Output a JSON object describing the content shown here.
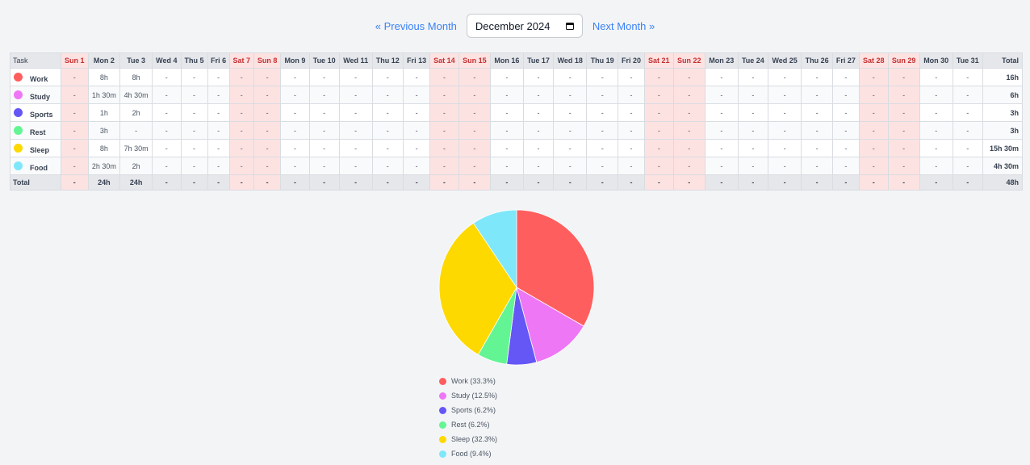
{
  "nav": {
    "prev_label": "« Previous Month",
    "next_label": "Next Month »",
    "month_value": "December 2024"
  },
  "table": {
    "task_header": "Task",
    "total_header": "Total",
    "days": [
      {
        "label": "Sun 1",
        "weekend": true
      },
      {
        "label": "Mon 2",
        "weekend": false
      },
      {
        "label": "Tue 3",
        "weekend": false
      },
      {
        "label": "Wed 4",
        "weekend": false
      },
      {
        "label": "Thu 5",
        "weekend": false
      },
      {
        "label": "Fri 6",
        "weekend": false
      },
      {
        "label": "Sat 7",
        "weekend": true
      },
      {
        "label": "Sun 8",
        "weekend": true
      },
      {
        "label": "Mon 9",
        "weekend": false
      },
      {
        "label": "Tue 10",
        "weekend": false
      },
      {
        "label": "Wed 11",
        "weekend": false
      },
      {
        "label": "Thu 12",
        "weekend": false
      },
      {
        "label": "Fri 13",
        "weekend": false
      },
      {
        "label": "Sat 14",
        "weekend": true
      },
      {
        "label": "Sun 15",
        "weekend": true
      },
      {
        "label": "Mon 16",
        "weekend": false
      },
      {
        "label": "Tue 17",
        "weekend": false
      },
      {
        "label": "Wed 18",
        "weekend": false
      },
      {
        "label": "Thu 19",
        "weekend": false
      },
      {
        "label": "Fri 20",
        "weekend": false
      },
      {
        "label": "Sat 21",
        "weekend": true
      },
      {
        "label": "Sun 22",
        "weekend": true
      },
      {
        "label": "Mon 23",
        "weekend": false
      },
      {
        "label": "Tue 24",
        "weekend": false
      },
      {
        "label": "Wed 25",
        "weekend": false
      },
      {
        "label": "Thu 26",
        "weekend": false
      },
      {
        "label": "Fri 27",
        "weekend": false
      },
      {
        "label": "Sat 28",
        "weekend": true
      },
      {
        "label": "Sun 29",
        "weekend": true
      },
      {
        "label": "Mon 30",
        "weekend": false
      },
      {
        "label": "Tue 31",
        "weekend": false
      }
    ],
    "empty_value": "-",
    "rows": [
      {
        "task": "Work",
        "color": "#ff5e5e",
        "cells": {
          "2": "8h",
          "3": "8h"
        },
        "total": "16h"
      },
      {
        "task": "Study",
        "color": "#ee77f5",
        "cells": {
          "2": "1h 30m",
          "3": "4h 30m"
        },
        "total": "6h"
      },
      {
        "task": "Sports",
        "color": "#6556f6",
        "cells": {
          "2": "1h",
          "3": "2h"
        },
        "total": "3h"
      },
      {
        "task": "Rest",
        "color": "#63f593",
        "cells": {
          "2": "3h"
        },
        "total": "3h"
      },
      {
        "task": "Sleep",
        "color": "#fdd900",
        "cells": {
          "2": "8h",
          "3": "7h 30m"
        },
        "total": "15h 30m"
      },
      {
        "task": "Food",
        "color": "#7fe7fa",
        "cells": {
          "2": "2h 30m",
          "3": "2h"
        },
        "total": "4h 30m"
      }
    ],
    "footer": {
      "label": "Total",
      "cells": {
        "2": "24h",
        "3": "24h"
      },
      "total": "48h"
    }
  },
  "chart_data": {
    "type": "pie",
    "slices": [
      {
        "label": "Work",
        "percent": 33.3,
        "color": "#ff5e5e",
        "legend": "Work (33.3%)"
      },
      {
        "label": "Study",
        "percent": 12.5,
        "color": "#ee77f5",
        "legend": "Study (12.5%)"
      },
      {
        "label": "Sports",
        "percent": 6.2,
        "color": "#6556f6",
        "legend": "Sports (6.2%)"
      },
      {
        "label": "Rest",
        "percent": 6.2,
        "color": "#63f593",
        "legend": "Rest (6.2%)"
      },
      {
        "label": "Sleep",
        "percent": 32.3,
        "color": "#fdd900",
        "legend": "Sleep (32.3%)"
      },
      {
        "label": "Food",
        "percent": 9.4,
        "color": "#7fe7fa",
        "legend": "Food (9.4%)"
      }
    ],
    "legend_position": "bottom"
  }
}
